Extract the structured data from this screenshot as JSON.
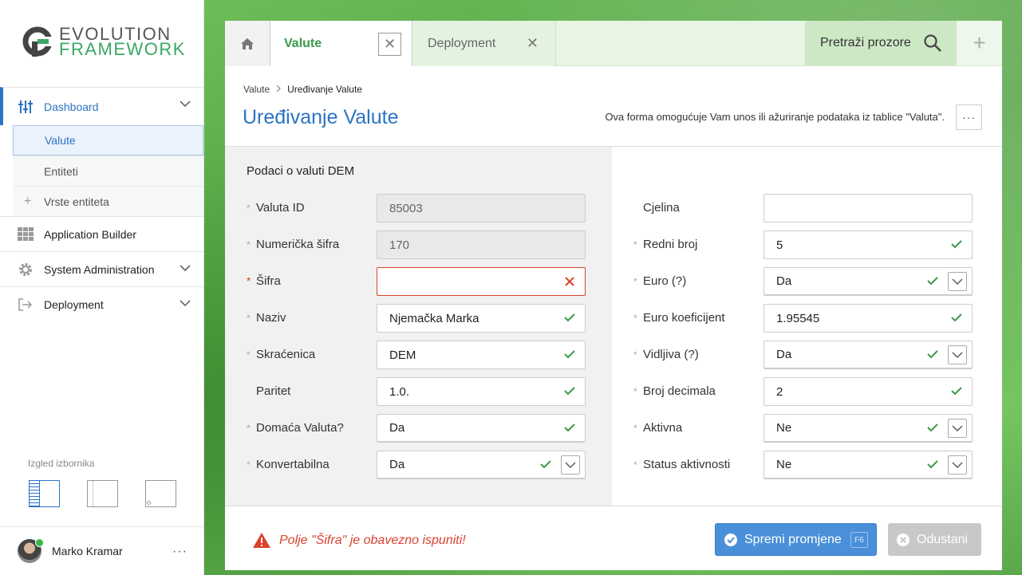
{
  "logo": {
    "line1": "EVOLUTION",
    "line2": "FRAMEWORK"
  },
  "sidebar": {
    "items": [
      {
        "label": "Dashboard",
        "icon": "sliders-icon",
        "active": true
      },
      {
        "label": "Application Builder",
        "icon": "grid-icon"
      },
      {
        "label": "System Administration",
        "icon": "gear-icon"
      },
      {
        "label": "Deployment",
        "icon": "deploy-icon"
      }
    ],
    "subitems": [
      {
        "label": "Valute",
        "selected": true
      },
      {
        "label": "Entiteti"
      },
      {
        "label": "Vrste entiteta",
        "icon": "plus-icon"
      }
    ],
    "layout_label": "Izgled izbornika",
    "user": {
      "name": "Marko Kramar",
      "more": "···"
    }
  },
  "tabs": {
    "active": "Valute",
    "inactive": "Deployment",
    "search": "Pretraži prozore",
    "close": "✕",
    "add": "+"
  },
  "header": {
    "breadcrumb": [
      "Valute",
      "Uređivanje Valute"
    ],
    "title": "Uređivanje Valute",
    "description": "Ova forma omogućuje Vam unos ili ažuriranje podataka iz tablice \"Valuta\".",
    "more": "···"
  },
  "form": {
    "section_title": "Podaci o valuti DEM",
    "left": [
      {
        "label": "Valuta ID",
        "value": "85003"
      },
      {
        "label": "Numerička šifra",
        "value": "170"
      },
      {
        "label": "Šifra",
        "value": ""
      },
      {
        "label": "Naziv",
        "value": "Njemačka Marka"
      },
      {
        "label": "Skraćenica",
        "value": "DEM"
      },
      {
        "label": "Paritet",
        "value": "1.0."
      },
      {
        "label": "Domaća Valuta?",
        "value": "Da"
      },
      {
        "label": "Konvertabilna",
        "value": "Da"
      }
    ],
    "right": [
      {
        "label": "Cjelina",
        "value": ""
      },
      {
        "label": "Redni broj",
        "value": "5"
      },
      {
        "label": "Euro (?)",
        "value": "Da"
      },
      {
        "label": "Euro koeficijent",
        "value": "1.95545"
      },
      {
        "label": "Vidljiva (?)",
        "value": "Da"
      },
      {
        "label": "Broj decimala",
        "value": "2"
      },
      {
        "label": "Aktivna",
        "value": "Ne"
      },
      {
        "label": "Status aktivnosti",
        "value": "Ne"
      }
    ]
  },
  "footer": {
    "error": "Polje \"Šifra\" je obavezno ispuniti!",
    "save": "Spremi promjene",
    "save_key": "F6",
    "cancel": "Odustani"
  },
  "colors": {
    "accent": "#2b74c4",
    "success": "#3a9a4a",
    "error": "#d9432e",
    "save": "#4a90d9"
  }
}
